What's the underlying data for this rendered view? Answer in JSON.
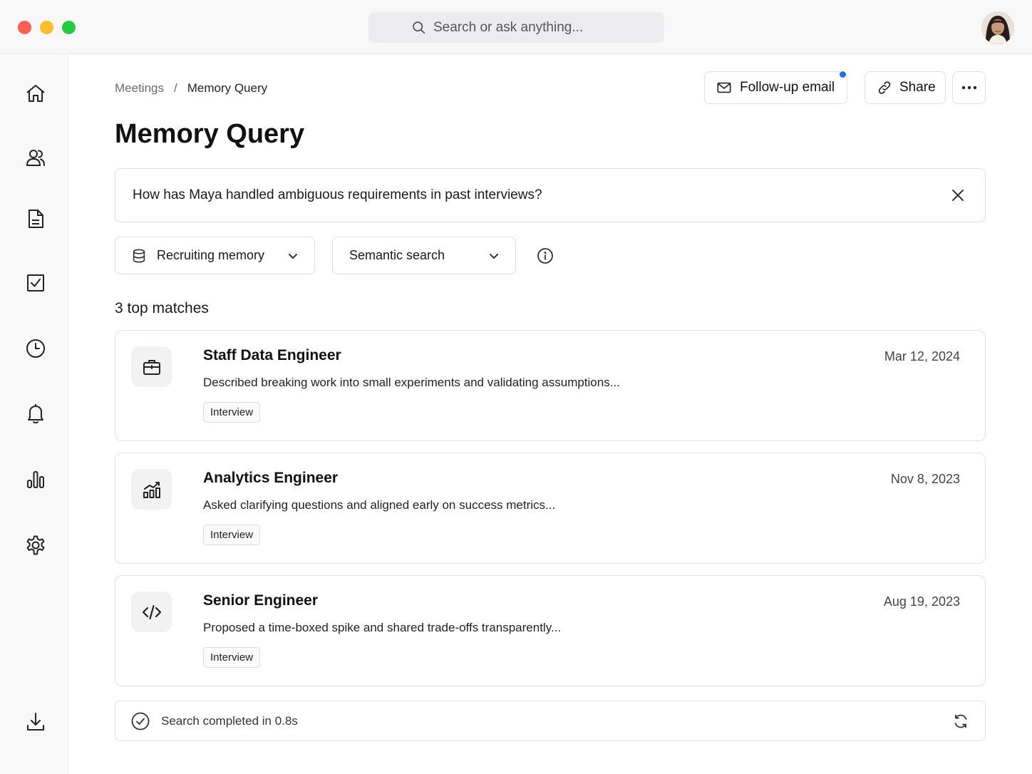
{
  "window": {
    "traffic_lights": {
      "close_color": "#fe5f57",
      "minimize_color": "#febc2e",
      "maximize_color": "#28c840"
    }
  },
  "topbar": {
    "search": {
      "placeholder": "Search or ask anything..."
    }
  },
  "sidebar": {
    "items": [
      {
        "icon": "home-icon"
      },
      {
        "icon": "people-icon"
      },
      {
        "icon": "document-icon"
      },
      {
        "icon": "checkbox-icon"
      },
      {
        "icon": "clock-icon"
      },
      {
        "icon": "bell-icon"
      },
      {
        "icon": "bar-chart-icon"
      },
      {
        "icon": "gear-icon"
      },
      {
        "icon": "download-icon"
      }
    ]
  },
  "header": {
    "breadcrumb": {
      "parent": "Meetings",
      "separator": "/",
      "current": "Memory Query"
    },
    "follow_up_label": "Follow-up email",
    "share_label": "Share",
    "accent_color": "#1a73e8"
  },
  "page_title": "Memory Query",
  "query": {
    "text": "How has Maya handled ambiguous requirements in past interviews?"
  },
  "filters": {
    "memory_source": "Recruiting memory",
    "search_mode": "Semantic search"
  },
  "results": {
    "heading": "3 top matches",
    "items": [
      {
        "icon": "briefcase-icon",
        "title": "Staff Data Engineer",
        "date": "Mar 12, 2024",
        "description": "Described breaking work into small experiments and validating assumptions...",
        "tag": "Interview"
      },
      {
        "icon": "analytics-chart-icon",
        "title": "Analytics Engineer",
        "date": "Nov 8, 2023",
        "description": "Asked clarifying questions and aligned early on success metrics...",
        "tag": "Interview"
      },
      {
        "icon": "code-icon",
        "title": "Senior Engineer",
        "date": "Aug 19, 2023",
        "description": "Proposed a time-boxed spike and shared trade-offs transparently...",
        "tag": "Interview"
      }
    ]
  },
  "status": {
    "text": "Search completed in 0.8s"
  }
}
